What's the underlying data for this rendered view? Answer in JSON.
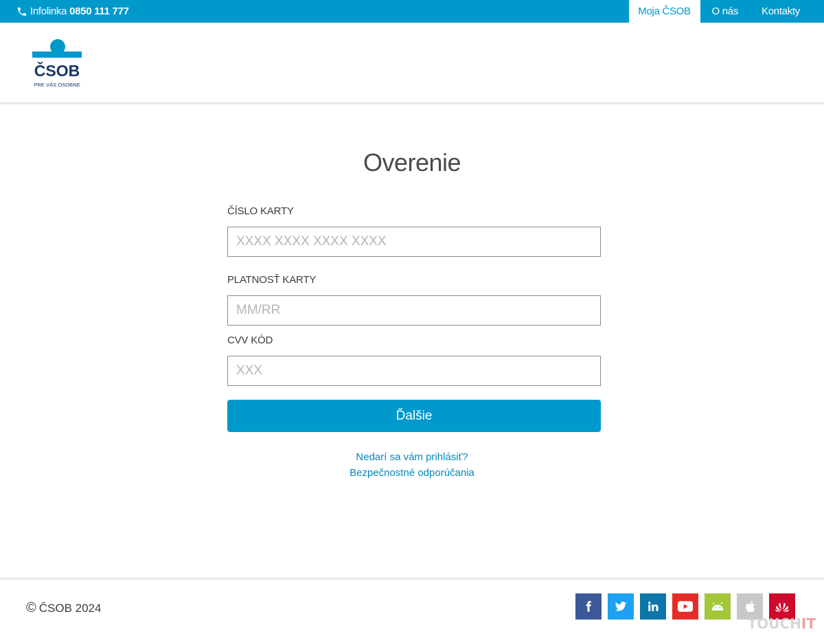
{
  "topbar": {
    "infoline_label": "Infolinka",
    "infoline_number": "0850 111 777",
    "nav": [
      {
        "label": "Moja ČSOB",
        "active": true
      },
      {
        "label": "O nás",
        "active": false
      },
      {
        "label": "Kontakty",
        "active": false
      }
    ]
  },
  "logo": {
    "name": "ČSOB",
    "tagline": "PRE VÁS OSOBNE"
  },
  "main": {
    "title": "Overenie",
    "card_number_label": "ČÍSLO KARTY",
    "card_number_placeholder": "XXXX XXXX XXXX XXXX",
    "card_expiry_label": "PLATNOSŤ KARTY",
    "card_expiry_placeholder": "MM/RR",
    "cvv_label": "CVV KÓD",
    "cvv_placeholder": "XXX",
    "next_button": "Ďalšie",
    "link_login_problem": "Nedarí sa vám prihlásiť?",
    "link_security": "Bezpečnostné odporúčania"
  },
  "footer": {
    "copyright_symbol": "©",
    "copyright": "ČSOB 2024",
    "social": [
      {
        "icon": "facebook-icon",
        "color": "#3b5998"
      },
      {
        "icon": "twitter-icon",
        "color": "#1da1f2"
      },
      {
        "icon": "linkedin-icon",
        "color": "#0e76a8"
      },
      {
        "icon": "youtube-icon",
        "color": "#e52d27"
      },
      {
        "icon": "android-icon",
        "color": "#a4c639"
      },
      {
        "icon": "apple-icon",
        "color": "#c8c8c8"
      },
      {
        "icon": "huawei-icon",
        "color": "#cf0a2c"
      }
    ],
    "watermark_a": "TOUCH",
    "watermark_b": "IT"
  },
  "colors": {
    "brand_blue": "#0099cc",
    "logo_navy": "#1a3668"
  }
}
